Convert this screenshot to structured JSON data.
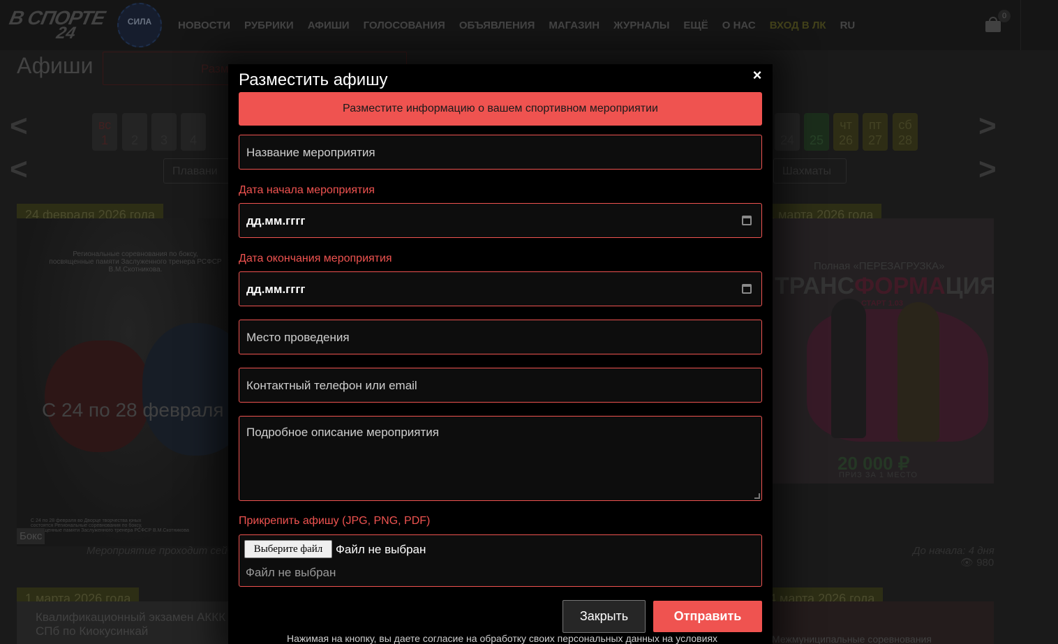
{
  "header": {
    "logo_main": "В СПОРТЕ",
    "logo_num": "24",
    "logo2_text": "СИЛА",
    "menu": [
      "НОВОСТИ",
      "РУБРИКИ",
      "АФИШИ",
      "ГОЛОСОВАНИЯ",
      "ОБЪЯВЛЕНИЯ",
      "МАГАЗИН",
      "ЖУРНАЛЫ",
      "ЕЩЁ",
      "О НАС"
    ],
    "login": "ВХОД В ЛК",
    "lang": "RU",
    "cart_count": "0"
  },
  "page": {
    "title": "Афиши",
    "post_button_partial": "Разме",
    "arrow_left": "<",
    "arrow_right": ">",
    "days_left": [
      {
        "dow": "вс",
        "num": "1"
      },
      {
        "dow": "",
        "num": "2"
      },
      {
        "dow": "",
        "num": "3"
      },
      {
        "dow": "",
        "num": "4"
      }
    ],
    "days_right": [
      {
        "dow": "",
        "num": "24"
      },
      {
        "dow": "",
        "num": "25"
      },
      {
        "dow": "чт",
        "num": "26"
      },
      {
        "dow": "пт",
        "num": "27"
      },
      {
        "dow": "сб",
        "num": "28"
      }
    ],
    "categories": [
      "Плавани",
      "Шахматы"
    ]
  },
  "cards": {
    "left": {
      "date": "24 февраля 2026 года",
      "desc_line1": "Региональные соревнования по боксу,",
      "desc_line2": "посвященные памяти Заслуженного тренера РСФСР",
      "desc_line3": "В.М.Скотникова.",
      "big_text": "С 24 по 28 февраля",
      "footer_line1": "С 24 по 28 февраля во Дворце творчества юных",
      "footer_line2": "состоятся Региональные соревнования по боксу,",
      "footer_line3": "посвященные памяти Заслуженного тренера РСФСР В.М.Скотникова",
      "tag": "Бокс",
      "note": "Мероприятие проходит сейч"
    },
    "right": {
      "date": "1 марта 2026 года",
      "poster_top": "Полная «ПЕРЕЗАГРУЗКА»",
      "poster_head_a": "ТРАНС",
      "poster_head_b": "ФОРМА",
      "poster_head_c": "ЦИЯ",
      "poster_start": "СТАРТ 1.03",
      "poster_prize": "20 000 ₽",
      "poster_prize_sub": "ПРИЗ ЗА 1 МЕСТО",
      "note": "До начала: 4 дня",
      "views": "980"
    },
    "bottom_left": {
      "date": "1 марта 2026 года",
      "title_line1": "Квалификационный экзамен АККК",
      "title_line2": "СПб по Киокусинкай"
    },
    "bottom_right": {
      "date": "4 марта 2026 года",
      "title": "Межмуниципальные соревнования"
    }
  },
  "modal": {
    "title": "Разместить афишу",
    "close_icon": "×",
    "banner": "Разместите информацию о вашем спортивном мероприятии",
    "name_placeholder": "Название мероприятия",
    "start_label": "Дата начала мероприятия",
    "start_value": "дд.мм.гггг",
    "end_label": "Дата окончания мероприятия",
    "end_value": "дд.мм.гггг",
    "place_placeholder": "Место проведения",
    "contact_placeholder": "Контактный телефон или email",
    "description_placeholder": "Подробное описание мероприятия",
    "file_label": "Прикрепить афишу (JPG, PNG, PDF)",
    "file_button": "Выберите файл",
    "file_status": "Файл не выбран",
    "file_hint": "Файл не выбран",
    "close_button": "Закрыть",
    "send_button": "Отправить",
    "consent": "Нажимая на кнопку, вы даете согласие на обработку своих персональных данных на условиях"
  },
  "colors": {
    "accent": "#ef5350",
    "modal_bg": "#000000",
    "olive": "#4a4b22"
  }
}
